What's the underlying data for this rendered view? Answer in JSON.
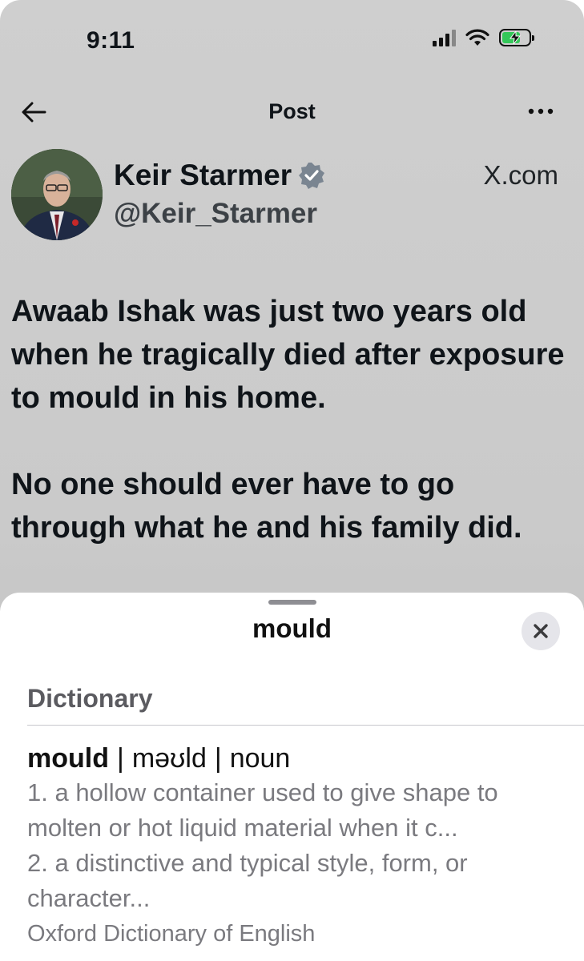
{
  "status_bar": {
    "time": "9:11",
    "battery_color": "#34c759",
    "icons": [
      "cellular-signal-icon",
      "wifi-icon",
      "battery-charging-icon"
    ]
  },
  "nav": {
    "title": "Post",
    "back_icon": "arrow-left-icon",
    "more_icon": "more-horizontal-icon"
  },
  "author": {
    "name": "Keir Starmer",
    "handle": "@Keir_Starmer",
    "verified_icon": "verified-badge-icon",
    "source": "X.com"
  },
  "post": {
    "paragraphs": [
      "Awaab Ishak was just two years old when he tragically died after exposure to mould in his home.",
      "No one should ever have to go through what he and his family did."
    ]
  },
  "lookup_sheet": {
    "title": "mould",
    "close_icon": "close-icon",
    "section": "Dictionary",
    "entry": {
      "headword": "mould",
      "pronunciation": "məʊld",
      "part_of_speech": "noun",
      "definitions": [
        "1. a hollow container used to give shape to molten or hot liquid material when it c...",
        "2. a distinctive and typical style, form, or character..."
      ],
      "source": "Oxford Dictionary of English"
    }
  }
}
